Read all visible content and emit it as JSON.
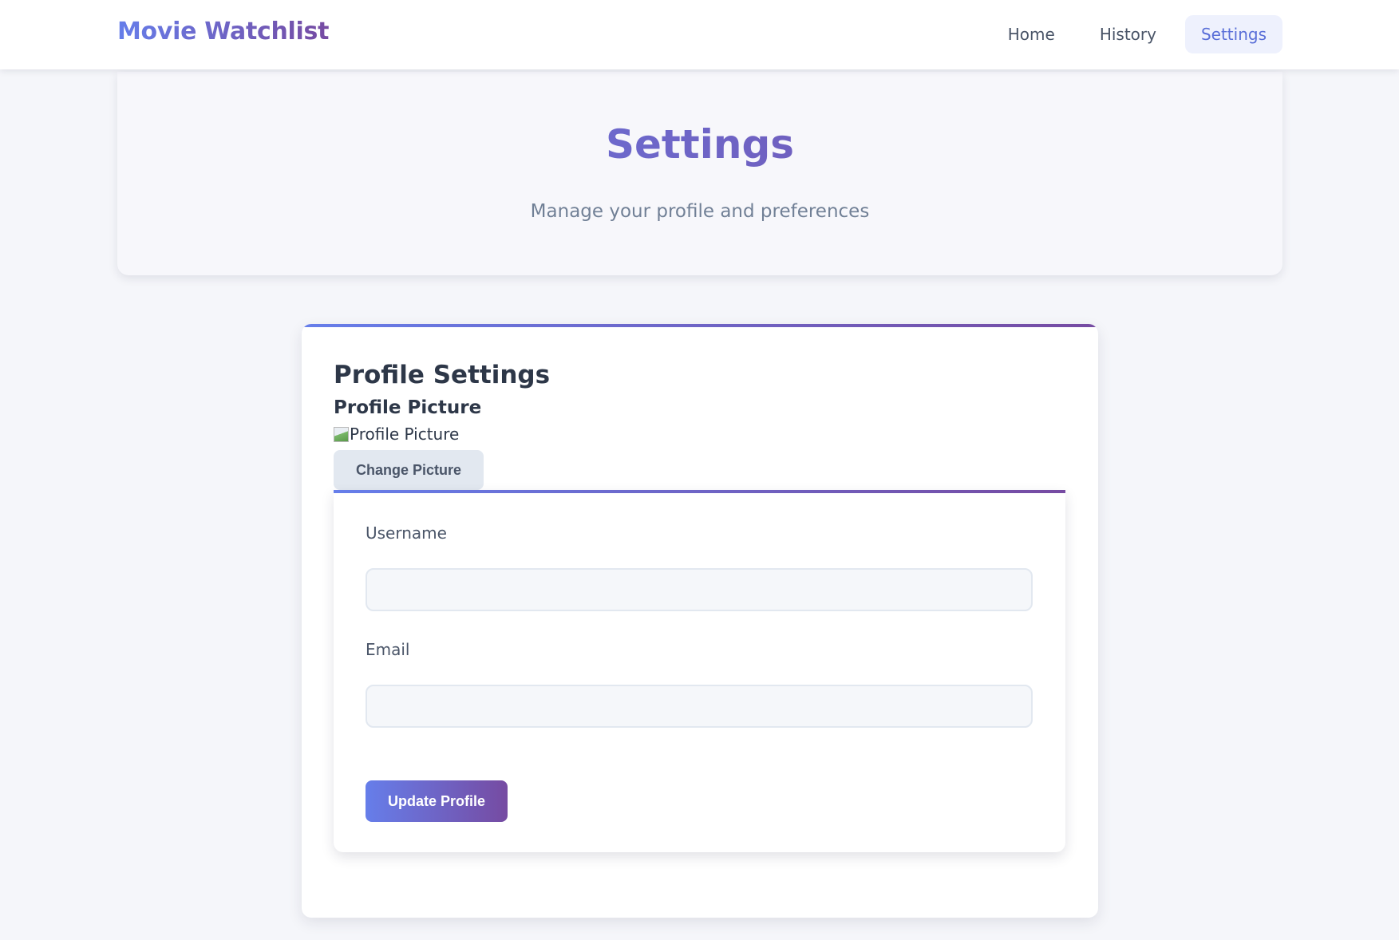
{
  "navbar": {
    "brand": "Movie Watchlist",
    "links": [
      {
        "label": "Home",
        "active": false
      },
      {
        "label": "History",
        "active": false
      },
      {
        "label": "Settings",
        "active": true
      }
    ]
  },
  "header": {
    "title": "Settings",
    "subtitle": "Manage your profile and preferences"
  },
  "profile": {
    "section_title": "Profile Settings",
    "picture_title": "Profile Picture",
    "picture_alt": "Profile Picture",
    "change_picture_label": "Change Picture",
    "form": {
      "username_label": "Username",
      "username_value": "",
      "email_label": "Email",
      "email_value": "",
      "submit_label": "Update Profile"
    }
  },
  "colors": {
    "accent_start": "#667eea",
    "accent_end": "#764ba2",
    "background": "#f5f6fa"
  }
}
